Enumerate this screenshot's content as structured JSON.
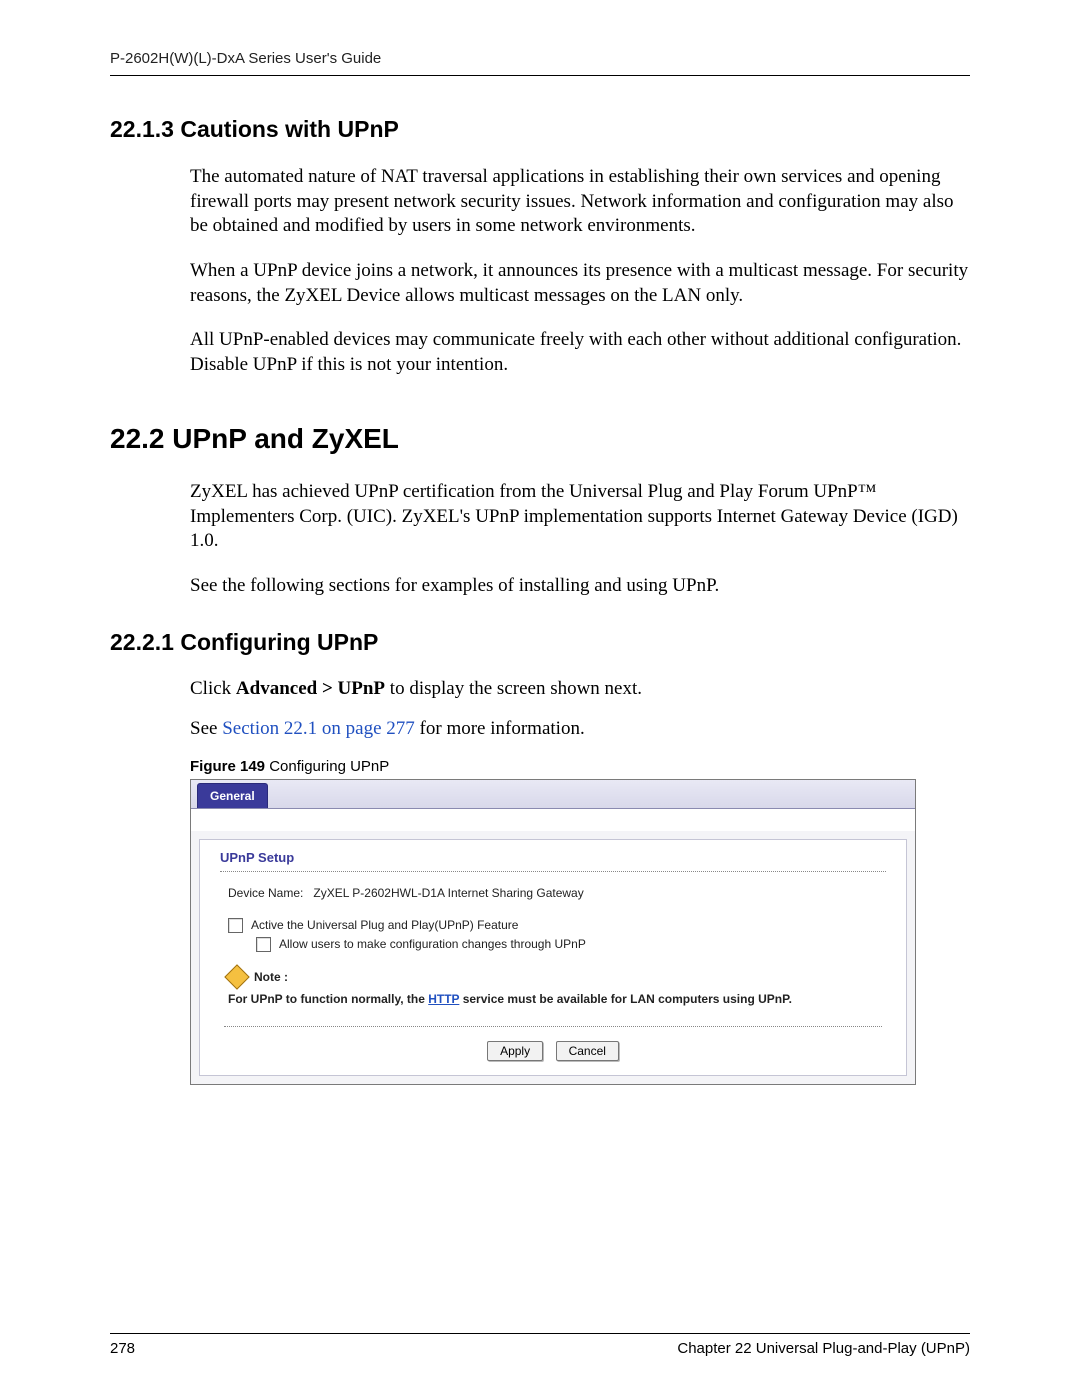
{
  "header": {
    "running": "P-2602H(W)(L)-DxA Series User's Guide"
  },
  "s1": {
    "heading": "22.1.3  Cautions with UPnP",
    "p1": "The automated nature of NAT traversal applications in establishing their own services and opening firewall ports may present network security issues. Network information and configuration may also be obtained and modified by users in some network environments.",
    "p2": "When a UPnP device joins a network, it announces its presence with a multicast message. For security reasons, the ZyXEL Device allows multicast messages on the LAN only.",
    "p3": "All UPnP-enabled devices may communicate freely with each other without additional configuration. Disable UPnP if this is not your intention."
  },
  "s2": {
    "heading": "22.2  UPnP and ZyXEL",
    "p1": "ZyXEL has achieved UPnP certification from the Universal Plug and Play Forum UPnP™ Implementers Corp. (UIC). ZyXEL's UPnP implementation supports Internet Gateway Device (IGD) 1.0.",
    "p2": "See the following sections for examples of installing and using UPnP."
  },
  "s3": {
    "heading": "22.2.1  Configuring UPnP",
    "click_pre": "Click ",
    "click_bold": "Advanced > UPnP",
    "click_post": " to display the screen shown next.",
    "see_pre": "See ",
    "see_link": "Section 22.1 on page 277",
    "see_post": " for more information."
  },
  "figure": {
    "label_bold": "Figure 149",
    "label_rest": "   Configuring UPnP",
    "tab": "General",
    "panel_title": "UPnP Setup",
    "device_label": "Device Name:",
    "device_value": "ZyXEL P-2602HWL-D1A Internet Sharing Gateway",
    "cb1": "Active the Universal Plug and Play(UPnP) Feature",
    "cb2": "Allow users to make configuration changes through UPnP",
    "note_label": "Note :",
    "note_pre": "For UPnP to function normally, the ",
    "note_link": "HTTP",
    "note_post": " service must be available for LAN computers using UPnP.",
    "apply": "Apply",
    "cancel": "Cancel"
  },
  "footer": {
    "page": "278",
    "chapter": "Chapter 22 Universal Plug-and-Play (UPnP)"
  }
}
